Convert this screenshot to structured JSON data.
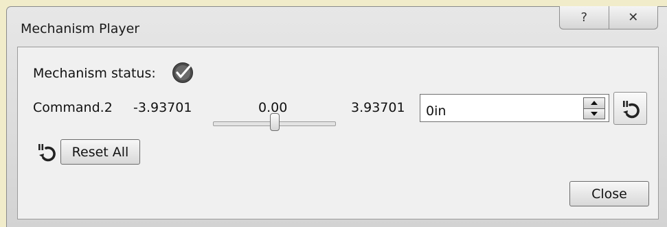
{
  "window": {
    "title": "Mechanism Player",
    "help_label": "?",
    "close_glyph": "✕"
  },
  "status": {
    "label": "Mechanism status:",
    "icon": "check-circle-icon"
  },
  "command": {
    "name": "Command.2",
    "min": "-3.93701",
    "current": "0.00",
    "max": "3.93701",
    "slider_position": 0.5,
    "input_value": "0in"
  },
  "buttons": {
    "reset_all": "Reset All",
    "close": "Close"
  }
}
